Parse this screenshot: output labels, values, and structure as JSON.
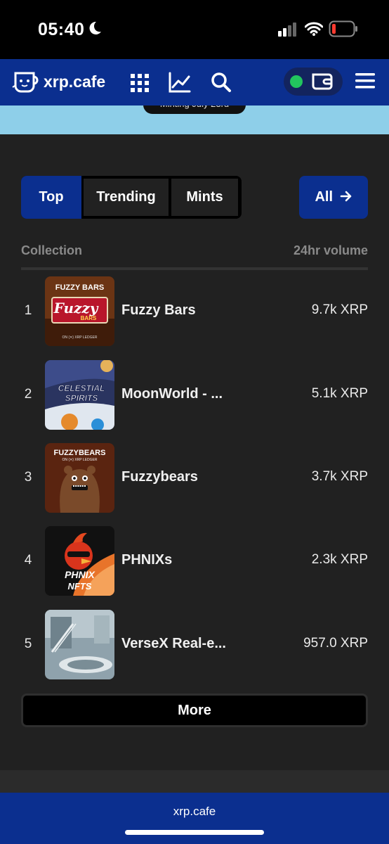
{
  "status_bar": {
    "time": "05:40"
  },
  "nav": {
    "logo_text": "xrp.cafe",
    "icons": [
      "grid-icon",
      "chart-trend-icon",
      "search-icon",
      "wallet-icon",
      "menu-icon"
    ],
    "wallet_status_color": "#22c55e"
  },
  "banner": {
    "text": "Minting July 23rd"
  },
  "tabs": [
    {
      "label": "Top",
      "active": true
    },
    {
      "label": "Trending",
      "active": false
    },
    {
      "label": "Mints",
      "active": false
    }
  ],
  "all_button": {
    "label": "All",
    "icon": "arrow-right-icon"
  },
  "table": {
    "col_collection": "Collection",
    "col_volume": "24hr volume",
    "rows": [
      {
        "rank": "1",
        "name": "Fuzzy Bars",
        "volume": "9.7k XRP",
        "thumb_title": "FUZZY BARS",
        "thumb_brand": "Fuzzy",
        "thumb_sub": "BARS",
        "thumb_footer": "ON {✕} XRP LEDGER"
      },
      {
        "rank": "2",
        "name": "MoonWorld - ...",
        "volume": "5.1k XRP",
        "thumb_title": "CELESTIAL",
        "thumb_brand": "SPIRITS"
      },
      {
        "rank": "3",
        "name": "Fuzzybears",
        "volume": "3.7k XRP",
        "thumb_title": "FUZZYBEARS",
        "thumb_sub": "ON {✕} XRP LEDGER"
      },
      {
        "rank": "4",
        "name": "PHNIXs",
        "volume": "2.3k XRP",
        "thumb_title": "PHNIX",
        "thumb_sub": "NFTS"
      },
      {
        "rank": "5",
        "name": "VerseX Real-e...",
        "volume": "957.0 XRP"
      }
    ]
  },
  "more_button": {
    "label": "More"
  },
  "footer": {
    "text": "xrp.cafe"
  },
  "colors": {
    "brand_blue": "#0b2f8f",
    "panel": "#212121"
  }
}
